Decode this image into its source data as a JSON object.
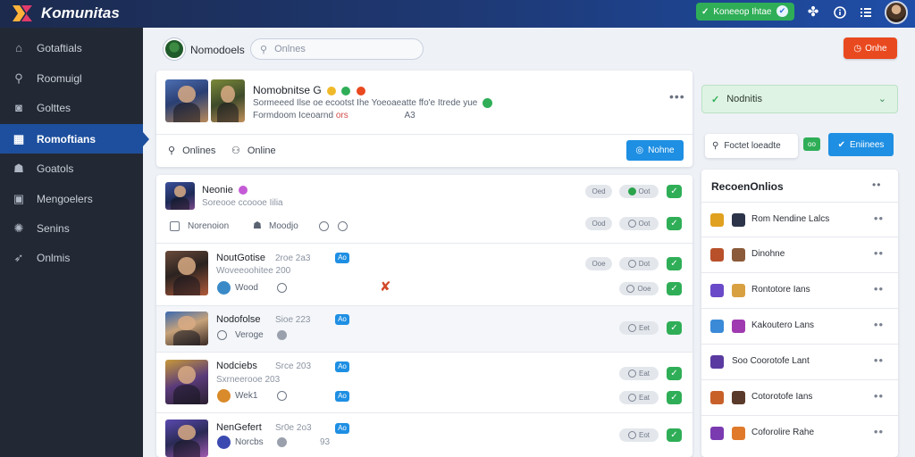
{
  "app": {
    "brand": "Komunitas"
  },
  "topbar": {
    "status_label": "Koneeop Ihtae",
    "icons": [
      "puzzle-icon",
      "info-icon",
      "menu-icon",
      "avatar"
    ]
  },
  "sidebar": {
    "items": [
      {
        "label": "Gotaftials",
        "icon": "home-icon"
      },
      {
        "label": "Roomuigl",
        "icon": "search-icon"
      },
      {
        "label": "Golttes",
        "icon": "camera-icon"
      },
      {
        "label": "Romoftians",
        "icon": "grid-icon",
        "active": true
      },
      {
        "label": "Goatols",
        "icon": "users-icon"
      },
      {
        "label": "Mengoelers",
        "icon": "image-icon"
      },
      {
        "label": "Senins",
        "icon": "settings-icon"
      },
      {
        "label": "Onlmis",
        "icon": "pin-icon"
      }
    ]
  },
  "subheader": {
    "name": "Nomodoels",
    "search_placeholder": "Onlnes",
    "action_button": "Onhe"
  },
  "featured": {
    "title": "Nomobnitse",
    "title_suffix": "G",
    "desc_line1": "Sormeeed Ilse oe ecootst Ihe Yoeoaeatte ffo'e Itrede yue",
    "desc_line2_a": "Formdoom Iceoarnd",
    "desc_line2_b": "ors",
    "desc_line2_c": "A3",
    "tab1": "Onlines",
    "tab2": "Online",
    "follow_button": "Nohne"
  },
  "feed": [
    {
      "name": "Neonie",
      "sub": "Soreooe ccoooe Iilia",
      "line2_label": "Norenoion",
      "line2_b": "Moodjo",
      "chips": [
        "Oed",
        "Oot"
      ],
      "chips2": [
        "Ood",
        "Oot"
      ]
    },
    {
      "name": "NoutGotise",
      "meta": "2roe 2a3",
      "sub": "Woveeoohitee 200",
      "line2_label": "Wood",
      "badge": "Ao",
      "chips": [
        "Ooe",
        "Dot"
      ],
      "chips2": [
        "Ooe"
      ]
    },
    {
      "name": "Nodofolse",
      "meta": "Sioe 223",
      "line2_label": "Veroge",
      "badge": "Ao",
      "chips": [
        "Eet"
      ]
    },
    {
      "name": "Nodciebs",
      "meta": "Srce 203",
      "sub": "Sxrneerooe 203",
      "line2_label": "Wek1",
      "badge": "Ao",
      "badge2": "Ao",
      "chips": [
        "Eat"
      ],
      "chips2": [
        "Eat"
      ]
    },
    {
      "name": "NenGefert",
      "meta": "Sr0e 2o3",
      "line2_label": "Norcbs",
      "line2_extra": "93",
      "badge": "Ao",
      "chips": [
        "Eot"
      ]
    }
  ],
  "rightpanel": {
    "dropdown_label": "Nodnitis",
    "input_label": "Foctet loeadte",
    "green_tag": "oo",
    "button": "Eniinees",
    "list_title": "RecoenOnlios",
    "items": [
      "Rom Nendine Lalcs",
      "Dinohne",
      "Rontotore Ians",
      "Kakoutero Lans",
      "Coorotofe Lant",
      "Cotorotofe Ians",
      "Coforolire Rahe"
    ],
    "items_prefix": [
      "",
      "",
      "",
      "",
      "Soo",
      "",
      ""
    ]
  },
  "colors": {
    "accent_blue": "#1e8fe3",
    "accent_green": "#2fae57",
    "accent_red": "#e9491f",
    "sidebar_bg": "#232934",
    "sidebar_active": "#1d4f9e"
  }
}
